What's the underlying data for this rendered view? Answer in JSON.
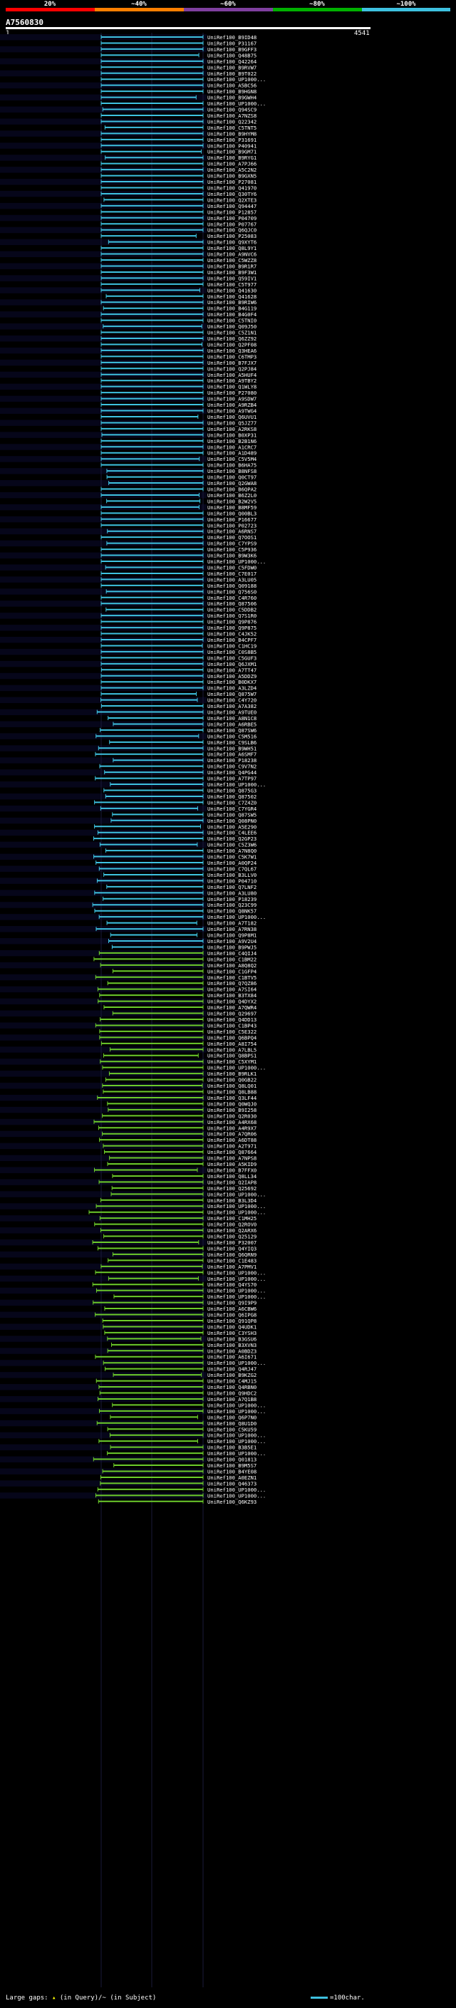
{
  "scale": {
    "labels": [
      "20%",
      "~40%",
      "~60%",
      "~80%",
      "~100%"
    ],
    "colors": [
      "#ff0000",
      "#ff7f00",
      "#7f3f9f",
      "#00b000",
      "#3ec1e0"
    ]
  },
  "query": {
    "id": "A7560830",
    "start_label": "1",
    "end_label": "4541",
    "length": 4541
  },
  "legend": {
    "prefix": "Large gaps: ",
    "q_symbol": "▴",
    "q_text": " (in Query)/",
    "s_symbol": "~",
    "s_text": " (in Subject)",
    "scale_text": "=100char."
  },
  "hits": [
    "UniRef100_B9ID48",
    "UniRef100_P31167",
    "UniRef100_B9GFF3",
    "UniRef100_Q48B75",
    "UniRef100_Q42264",
    "UniRef100_B9RVW7",
    "UniRef100_B9T022",
    "UniRef100_UP1000...",
    "UniRef100_A5BC56",
    "UniRef100_B9HGN8",
    "UniRef100_B9GWH4",
    "UniRef100_UP1000...",
    "UniRef100_Q94SC9",
    "UniRef100_A7NZS8",
    "UniRef100_Q22342",
    "UniRef100_C5TNT5",
    "UniRef100_B9HYM8",
    "UniRef100_P31691",
    "UniRef100_P40941",
    "UniRef100_B9GM71",
    "UniRef100_B9RYG1",
    "UniRef100_A7PJ66",
    "UniRef100_A5C2N2",
    "UniRef100_B9GXN5",
    "UniRef100_P27081",
    "UniRef100_Q41970",
    "UniRef100_Q30TY6",
    "UniRef100_Q2XTE3",
    "UniRef100_Q94447",
    "UniRef100_P12857",
    "UniRef100_P04709",
    "UniRef100_P07767",
    "UniRef100_Q6QJC0",
    "UniRef100_P25083",
    "UniRef100_Q9XYT6",
    "UniRef100_Q8L9Y1",
    "UniRef100_A9NVC6",
    "UniRef100_C5WZZ8",
    "UniRef100_B9R1R7",
    "UniRef100_B9F3W1",
    "UniRef100_Q59IV1",
    "UniRef100_C5T977",
    "UniRef100_Q41630",
    "UniRef100_Q41628",
    "UniRef100_B9RIW6",
    "UniRef100_B4G119",
    "UniRef100_B4G0F4",
    "UniRef100_C5TNI0",
    "UniRef100_Q09J50",
    "UniRef100_C5Z1N1",
    "UniRef100_Q6ZZ92",
    "UniRef100_Q2PF08",
    "UniRef100_Q3HEA6",
    "UniRef100_C6TMP3",
    "UniRef100_B7FJX7",
    "UniRef100_Q2PJ84",
    "UniRef100_A5HUF4",
    "UniRef100_A9TBY2",
    "UniRef100_Q1WLY8",
    "UniRef100_P27080",
    "UniRef100_A9SDW7",
    "UniRef100_A9RZB4",
    "UniRef100_A9TWG4",
    "UniRef100_Q6UVU1",
    "UniRef100_Q5JZ77",
    "UniRef100_A2RKS8",
    "UniRef100_B0XP31",
    "UniRef100_B2B1N6",
    "UniRef100_A1CRC7",
    "UniRef100_A1D489",
    "UniRef100_C5V5M4",
    "UniRef100_B6HA75",
    "UniRef100_B8NFS8",
    "UniRef100_Q0CT97",
    "UniRef100_Q2GWA8",
    "UniRef100_B6QPA2",
    "UniRef100_B6Z2L0",
    "UniRef100_B2W2V5",
    "UniRef100_B8MF59",
    "UniRef100_Q00BL3",
    "UniRef100_P16677",
    "UniRef100_P02723",
    "UniRef100_A6RNS7",
    "UniRef100_Q7OOS1",
    "UniRef100_C7YPS9",
    "UniRef100_C5P936",
    "UniRef100_B9W3K6",
    "UniRef100_UP1000...",
    "UniRef100_C5FDW0",
    "UniRef100_C7E017",
    "UniRef100_A3LU05",
    "UniRef100_Q09188",
    "UniRef100_Q756S0",
    "UniRef100_C4R760",
    "UniRef100_Q87506",
    "UniRef100_C5DDB2",
    "UniRef100_Q7S1R0",
    "UniRef100_Q9P876",
    "UniRef100_Q9P875",
    "UniRef100_C4JK52",
    "UniRef100_B4CPF7",
    "UniRef100_C1HC19",
    "UniRef100_C0S8B5",
    "UniRef100_C5GUF3",
    "UniRef100_Q6JXM1",
    "UniRef100_A7TT47",
    "UniRef100_A5DDZ9",
    "UniRef100_B0DKX7",
    "UniRef100_A3LZD4",
    "UniRef100_Q875W7",
    "UniRef100_C4Y720",
    "UniRef100_A7A382",
    "UniRef100_A9TUE0",
    "UniRef100_A8N1C8",
    "UniRef100_A6RBE5",
    "UniRef100_Q87SW6",
    "UniRef100_C5M516",
    "UniRef100_C9SLB6",
    "UniRef100_B9WH51",
    "UniRef100_A6SMF7",
    "UniRef100_P18238",
    "UniRef100_C9V7N2",
    "UniRef100_Q4PG44",
    "UniRef100_A7TP97",
    "UniRef100_UP1000...",
    "UniRef100_Q875G3",
    "UniRef100_Q87502",
    "UniRef100_C7Z4Z0",
    "UniRef100_C7YGR4",
    "UniRef100_Q87SW5",
    "UniRef100_Q08PN0",
    "UniRef100_A5E290",
    "UniRef100_C4LEE6",
    "UniRef100_Q2GP23",
    "UniRef100_C5Z3W6",
    "UniRef100_A7N8Q0",
    "UniRef100_C5K7W1",
    "UniRef100_A0QP24",
    "UniRef100_C7QL67",
    "UniRef100_B3LLV0",
    "UniRef100_P04710",
    "UniRef100_Q7LNF2",
    "UniRef100_A3LU80",
    "UniRef100_P18239",
    "UniRef100_Q23C99",
    "UniRef100_Q8NK57",
    "UniRef100_UP1000...",
    "UniRef100_A7T182",
    "UniRef100_A7RN38",
    "UniRef100_Q9P8M1",
    "UniRef100_A9V2U4",
    "UniRef100_B9PWJ5",
    "UniRef100_C4QIJ4",
    "UniRef100_C1BM22",
    "UniRef100_A8Q8Q2",
    "UniRef100_C1GFP4",
    "UniRef100_C1BTV5",
    "UniRef100_Q7QZ86",
    "UniRef100_A7SI64",
    "UniRef100_B3TX84",
    "UniRef100_Q4DYX2",
    "UniRef100_A7QWR4",
    "UniRef100_Q29697",
    "UniRef100_Q4DD13",
    "UniRef100_C1BP43",
    "UniRef100_C5E322",
    "UniRef100_Q6BPQ4",
    "UniRef100_A8I754",
    "UniRef100_A7LBL5",
    "UniRef100_Q8BPS1",
    "UniRef100_C5XYM1",
    "UniRef100_UP1000...",
    "UniRef100_B9RLK1",
    "UniRef100_Q0GB22",
    "UniRef100_Q8LQ01",
    "UniRef100_Q8LB88",
    "UniRef100_Q3LF44",
    "UniRef100_Q0WQJ0",
    "UniRef100_B9I258",
    "UniRef100_Q2R030",
    "UniRef100_A4RX68",
    "UniRef100_A4R9X7",
    "UniRef100_A7QR06",
    "UniRef100_A6DT88",
    "UniRef100_A2T971",
    "UniRef100_Q87664",
    "UniRef100_A7NPS8",
    "UniRef100_A5KID9",
    "UniRef100_B7FFX0",
    "UniRef100_Q8LL34",
    "UniRef100_Q2IAP8",
    "UniRef100_Q25692",
    "UniRef100_UP1000...",
    "UniRef100_B3L3D4",
    "UniRef100_UP1000...",
    "UniRef100_UP1000...",
    "UniRef100_C1MH25",
    "UniRef100_Q2ROV0",
    "UniRef100_Q2ARX6",
    "UniRef100_Q25129",
    "UniRef100_P32007",
    "UniRef100_Q4YIQ3",
    "UniRef100_Q6QRN9",
    "UniRef100_C1E483",
    "UniRef100_A7PMV1",
    "UniRef100_UP1000...",
    "UniRef100_UP1000...",
    "UniRef100_Q4YS70",
    "UniRef100_UP1000...",
    "UniRef100_UP1000...",
    "UniRef100_Q9I9P9",
    "UniRef100_A6CBW6",
    "UniRef100_Q6IPG8",
    "UniRef100_Q91QP8",
    "UniRef100_Q4UDK1",
    "UniRef100_C3YSH3",
    "UniRef100_B3GSU6",
    "UniRef100_B3XVN3",
    "UniRef100_A0BDZ3",
    "UniRef100_A6I671",
    "UniRef100_UP1000...",
    "UniRef100_Q4RJ47",
    "UniRef100_B9KZG2",
    "UniRef100_C4MJ15",
    "UniRef100_Q4RBN0",
    "UniRef100_Q9HDC2",
    "UniRef100_A7Q1B8",
    "UniRef100_UP1000...",
    "UniRef100_UP1000...",
    "UniRef100_Q6P7N0",
    "UniRef100_Q8U1D0",
    "UniRef100_C5KU59",
    "UniRef100_UP1000...",
    "UniRef100_UP1000...",
    "UniRef100_B3B5E1",
    "UniRef100_UP1000...",
    "UniRef100_Q01813",
    "UniRef100_B9M5S7",
    "UniRef100_B4YE08",
    "UniRef100_A0EZN1",
    "UniRef100_Q46373",
    "UniRef100_UP1000...",
    "UniRef100_UP1000...",
    "UniRef100_Q6KZ93"
  ]
}
